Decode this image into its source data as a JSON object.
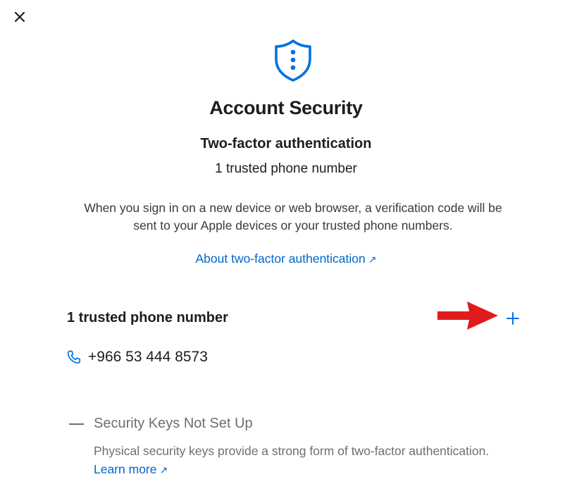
{
  "header": {
    "title": "Account Security"
  },
  "two_factor": {
    "subtitle": "Two-factor authentication",
    "phone_count": "1 trusted phone number",
    "description": "When you sign in on a new device or web browser, a verification code will be sent to your Apple devices or your trusted phone numbers.",
    "about_link": "About two-factor authentication",
    "link_arrow": "↗"
  },
  "trusted_phones": {
    "heading": "1 trusted phone number",
    "add_label": "+",
    "numbers": [
      "+966 53 444 8573"
    ]
  },
  "security_keys": {
    "title": "Security Keys Not Set Up",
    "description": "Physical security keys provide a strong form of two-factor authentication.",
    "learn_more": "Learn more",
    "link_arrow": "↗"
  },
  "colors": {
    "accent": "#0066cc",
    "text": "#1d1d1f",
    "muted": "#6e6e73",
    "annotation_arrow": "#e01b1b"
  },
  "icons": [
    "close-icon",
    "shield-icon",
    "plus-icon",
    "phone-icon",
    "red-arrow-annotation"
  ]
}
